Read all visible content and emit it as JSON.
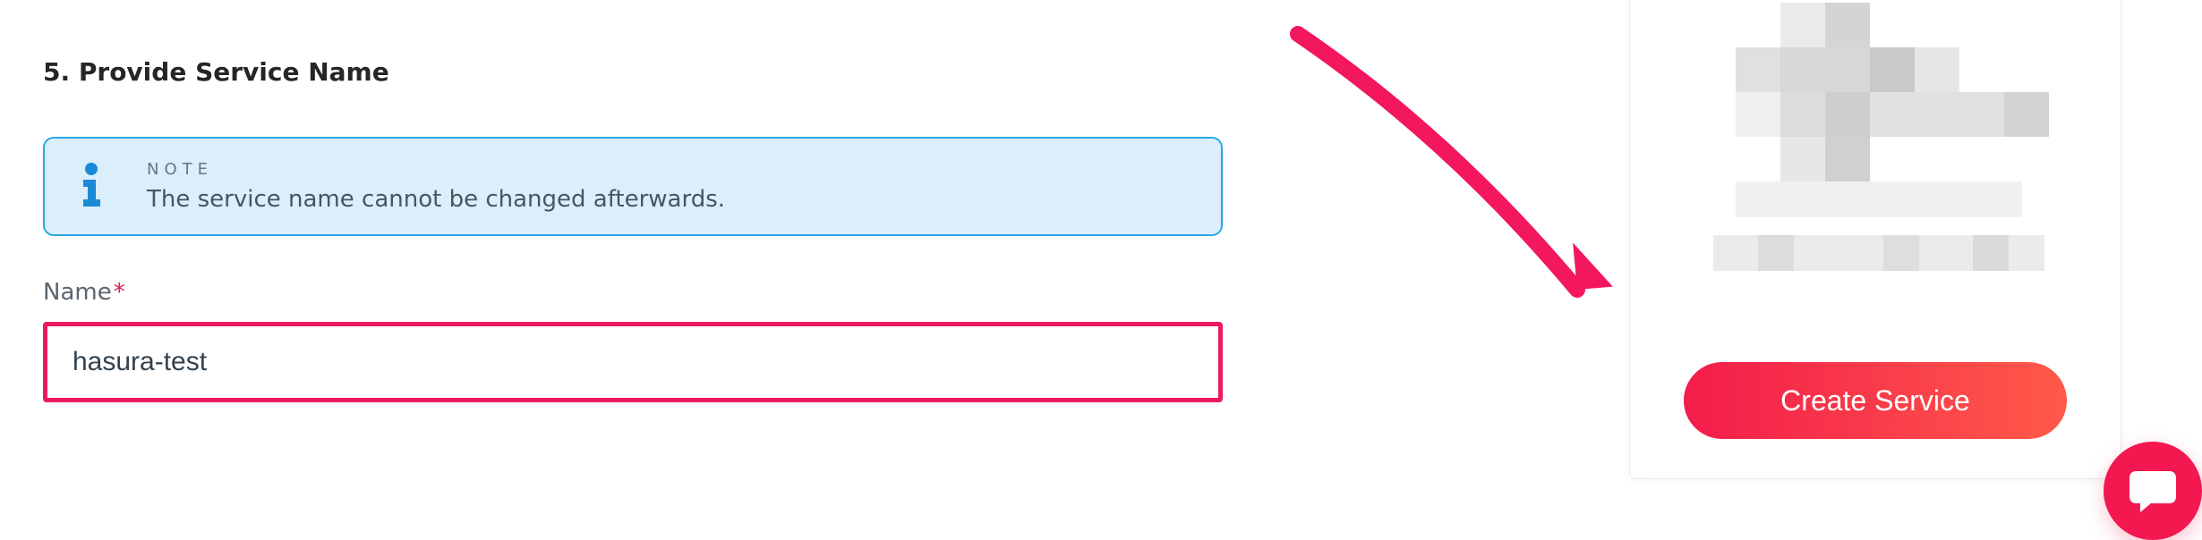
{
  "step": {
    "heading": "5. Provide Service Name"
  },
  "note": {
    "label": "NOTE",
    "text": "The service name cannot be changed afterwards."
  },
  "field": {
    "label": "Name",
    "required_mark": "*",
    "value": "hasura-test"
  },
  "action": {
    "create_label": "Create Service"
  },
  "colors": {
    "note_border": "#2aa9e0",
    "note_bg": "#dbeefc",
    "input_highlight": "#ec1963",
    "cta_gradient_from": "#f31c4b",
    "cta_gradient_to": "#ff5a49",
    "arrow": "#f3175d",
    "chat": "#f41850"
  }
}
